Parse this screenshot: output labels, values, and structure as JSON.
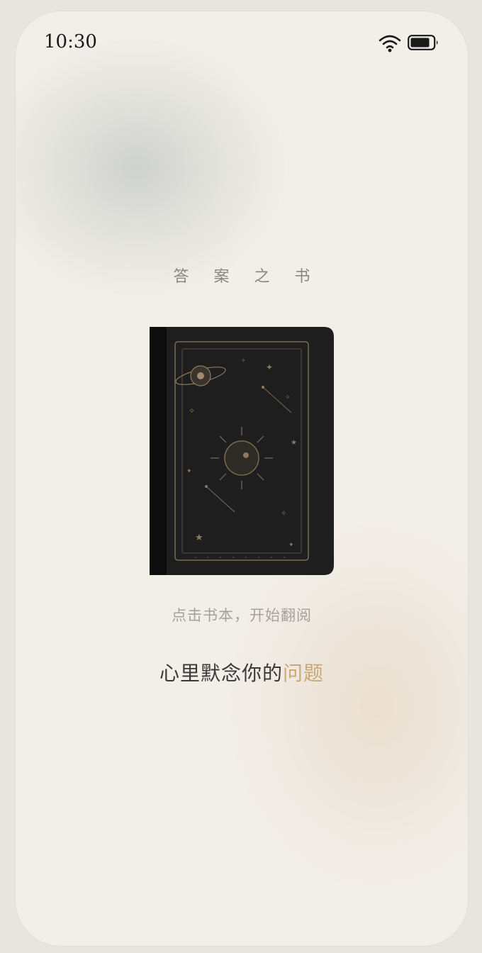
{
  "status_bar": {
    "time": "10:30",
    "wifi_icon": "wifi-icon",
    "battery_icon": "battery-icon"
  },
  "app": {
    "title": "答 案 之 书"
  },
  "book": {
    "icon": "book-cover-celestial-icon",
    "cover_color": "#1e1e1e",
    "spine_color": "#0d0d0d",
    "ornament_color": "#8c7a5e"
  },
  "hint": "点击书本，开始翻阅",
  "prompt": {
    "lead": "心里默念你的",
    "accent": "问题"
  },
  "colors": {
    "accent": "#c9a777",
    "text_primary": "#3b3a38",
    "text_muted": "#a5a19c",
    "background": "#f2efe9"
  }
}
